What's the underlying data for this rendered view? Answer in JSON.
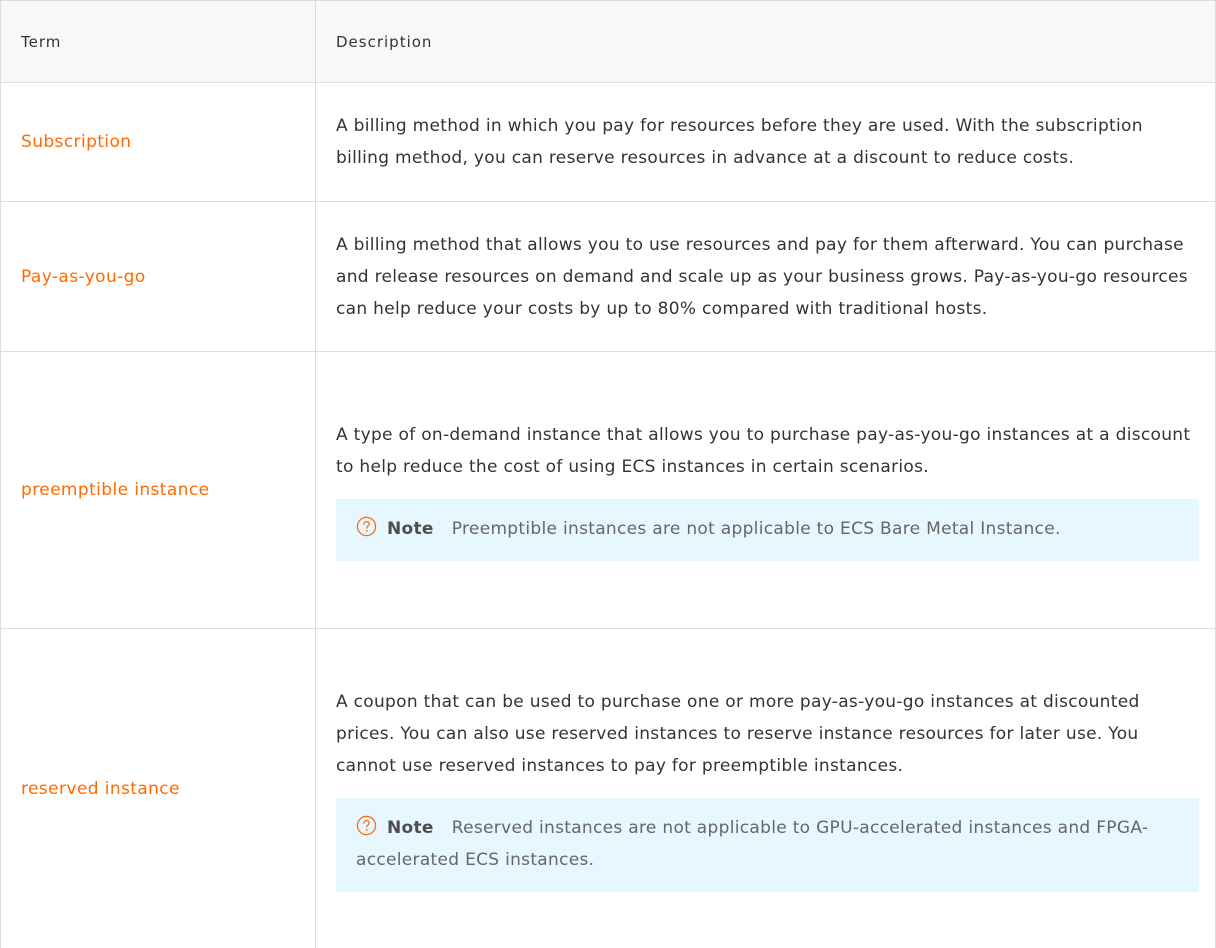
{
  "table": {
    "headers": {
      "term": "Term",
      "description": "Description"
    },
    "rows": [
      {
        "term": "Subscription",
        "description": "A billing method in which you pay for resources before they are used. With the subscription billing method, you can reserve resources in advance at a discount to reduce costs."
      },
      {
        "term": "Pay-as-you-go",
        "description": "A billing method that allows you to use resources and pay for them afterward. You can purchase and release resources on demand and scale up as your business grows. Pay-as-you-go resources can help reduce your costs by up to 80% compared with traditional hosts."
      },
      {
        "term": "preemptible instance",
        "description": "A type of on-demand instance that allows you to purchase pay-as-you-go instances at a discount to help reduce the cost of using ECS instances in certain scenarios.",
        "note": {
          "icon": "question-circle-icon",
          "label": "Note",
          "text": "Preemptible instances are not applicable to ECS Bare Metal Instance."
        }
      },
      {
        "term": "reserved instance",
        "description": "A coupon that can be used to purchase one or more pay-as-you-go instances at discounted prices. You can also use reserved instances to reserve instance resources for later use. You cannot use reserved instances to pay for preemptible instances.",
        "note": {
          "icon": "question-circle-icon",
          "label": "Note",
          "text": "Reserved instances are not applicable to GPU-accelerated instances and FPGA-accelerated ECS instances."
        }
      }
    ]
  },
  "colors": {
    "term": "#ff6a00",
    "header_bg": "#f8f8f8",
    "note_bg": "#e7f7ff",
    "note_icon": "#ff6a00",
    "border": "#dddddd"
  }
}
